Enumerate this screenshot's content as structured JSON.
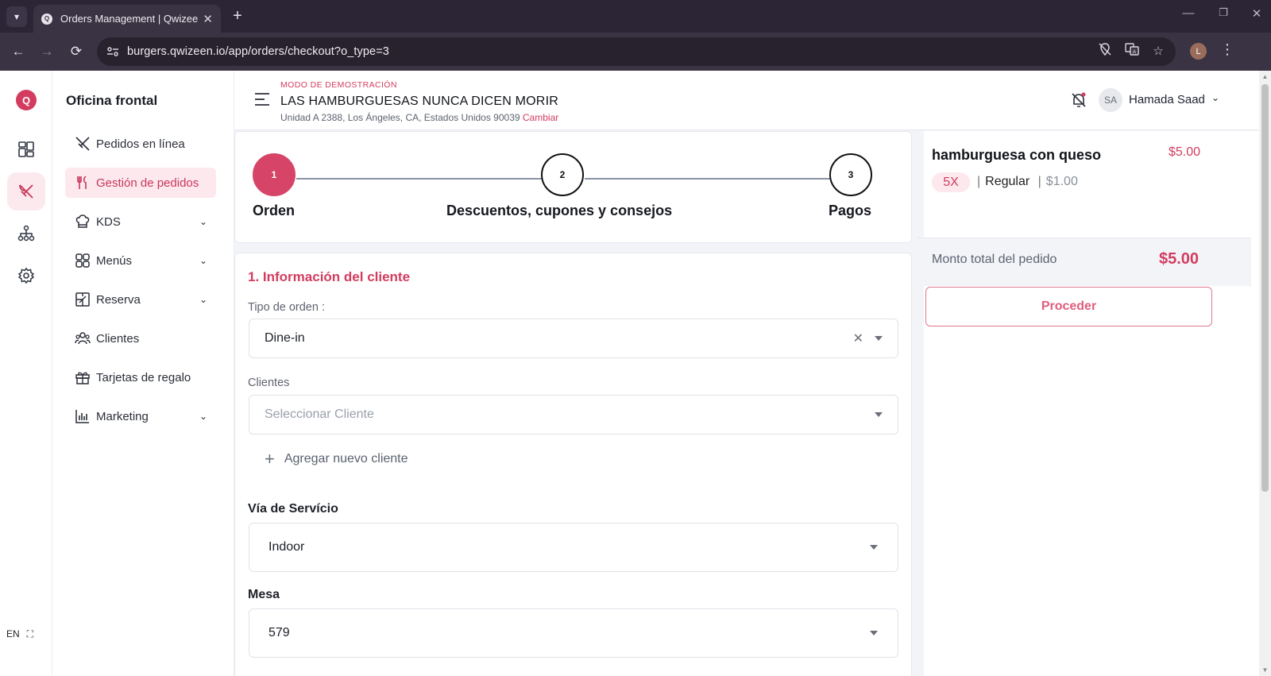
{
  "browser": {
    "tab_title": "Orders Management | Qwizeen",
    "url": "burgers.qwizeen.io/app/orders/checkout?o_type=3",
    "profile_initial": "L"
  },
  "rail": {
    "logo": "Q",
    "lang": "EN",
    "icons": [
      "dashboard-icon",
      "utensils-icon",
      "org-chart-icon",
      "gear-icon"
    ]
  },
  "sidebar": {
    "title": "Oficina frontal",
    "items": [
      {
        "label": "Pedidos en línea",
        "icon": "utensils-icon",
        "expandable": false,
        "active": false
      },
      {
        "label": "Gestión de pedidos",
        "icon": "fork-icon",
        "expandable": false,
        "active": true
      },
      {
        "label": "KDS",
        "icon": "chef-hat-icon",
        "expandable": true,
        "active": false
      },
      {
        "label": "Menús",
        "icon": "grid-icon",
        "expandable": true,
        "active": false
      },
      {
        "label": "Reserva",
        "icon": "floorplan-icon",
        "expandable": true,
        "active": false
      },
      {
        "label": "Clientes",
        "icon": "users-icon",
        "expandable": false,
        "active": false
      },
      {
        "label": "Tarjetas de regalo",
        "icon": "gift-icon",
        "expandable": false,
        "active": false
      },
      {
        "label": "Marketing",
        "icon": "bar-chart-icon",
        "expandable": true,
        "active": false
      }
    ]
  },
  "header": {
    "demo_label": "MODO DE DEMOSTRACIÓN",
    "store_name": "LAS HAMBURGUESAS NUNCA DICEN MORIR",
    "address": "Unidad A 2388, Los Ángeles, CA, Estados Unidos 90039",
    "change_link": "Cambiar",
    "user_initials": "SA",
    "user_name": "Hamada Saad"
  },
  "stepper": {
    "steps": [
      {
        "number": "1",
        "label": "Orden",
        "active": true
      },
      {
        "number": "2",
        "label": "Descuentos, cupones y consejos",
        "active": false
      },
      {
        "number": "3",
        "label": "Pagos",
        "active": false
      }
    ]
  },
  "form": {
    "section_title": "1. Información del cliente",
    "order_type_label": "Tipo de orden :",
    "order_type_value": "Dine-in",
    "clients_label": "Clientes",
    "clients_placeholder": "Seleccionar Cliente",
    "add_client": "Agregar nuevo cliente",
    "service_label": "Vía de Servício",
    "service_value": "Indoor",
    "table_label": "Mesa",
    "table_value": "579"
  },
  "summary": {
    "item_name": "hamburguesa con queso",
    "item_price": "$5.00",
    "quantity": "5X",
    "size": "Regular",
    "unit_price": "$1.00",
    "total_label": "Monto total del pedido",
    "total_value": "$5.00",
    "proceed_label": "Proceder"
  },
  "colors": {
    "accent": "#d33c5f",
    "active_bg": "#fde8ee",
    "browser_dark": "#2b2536"
  }
}
